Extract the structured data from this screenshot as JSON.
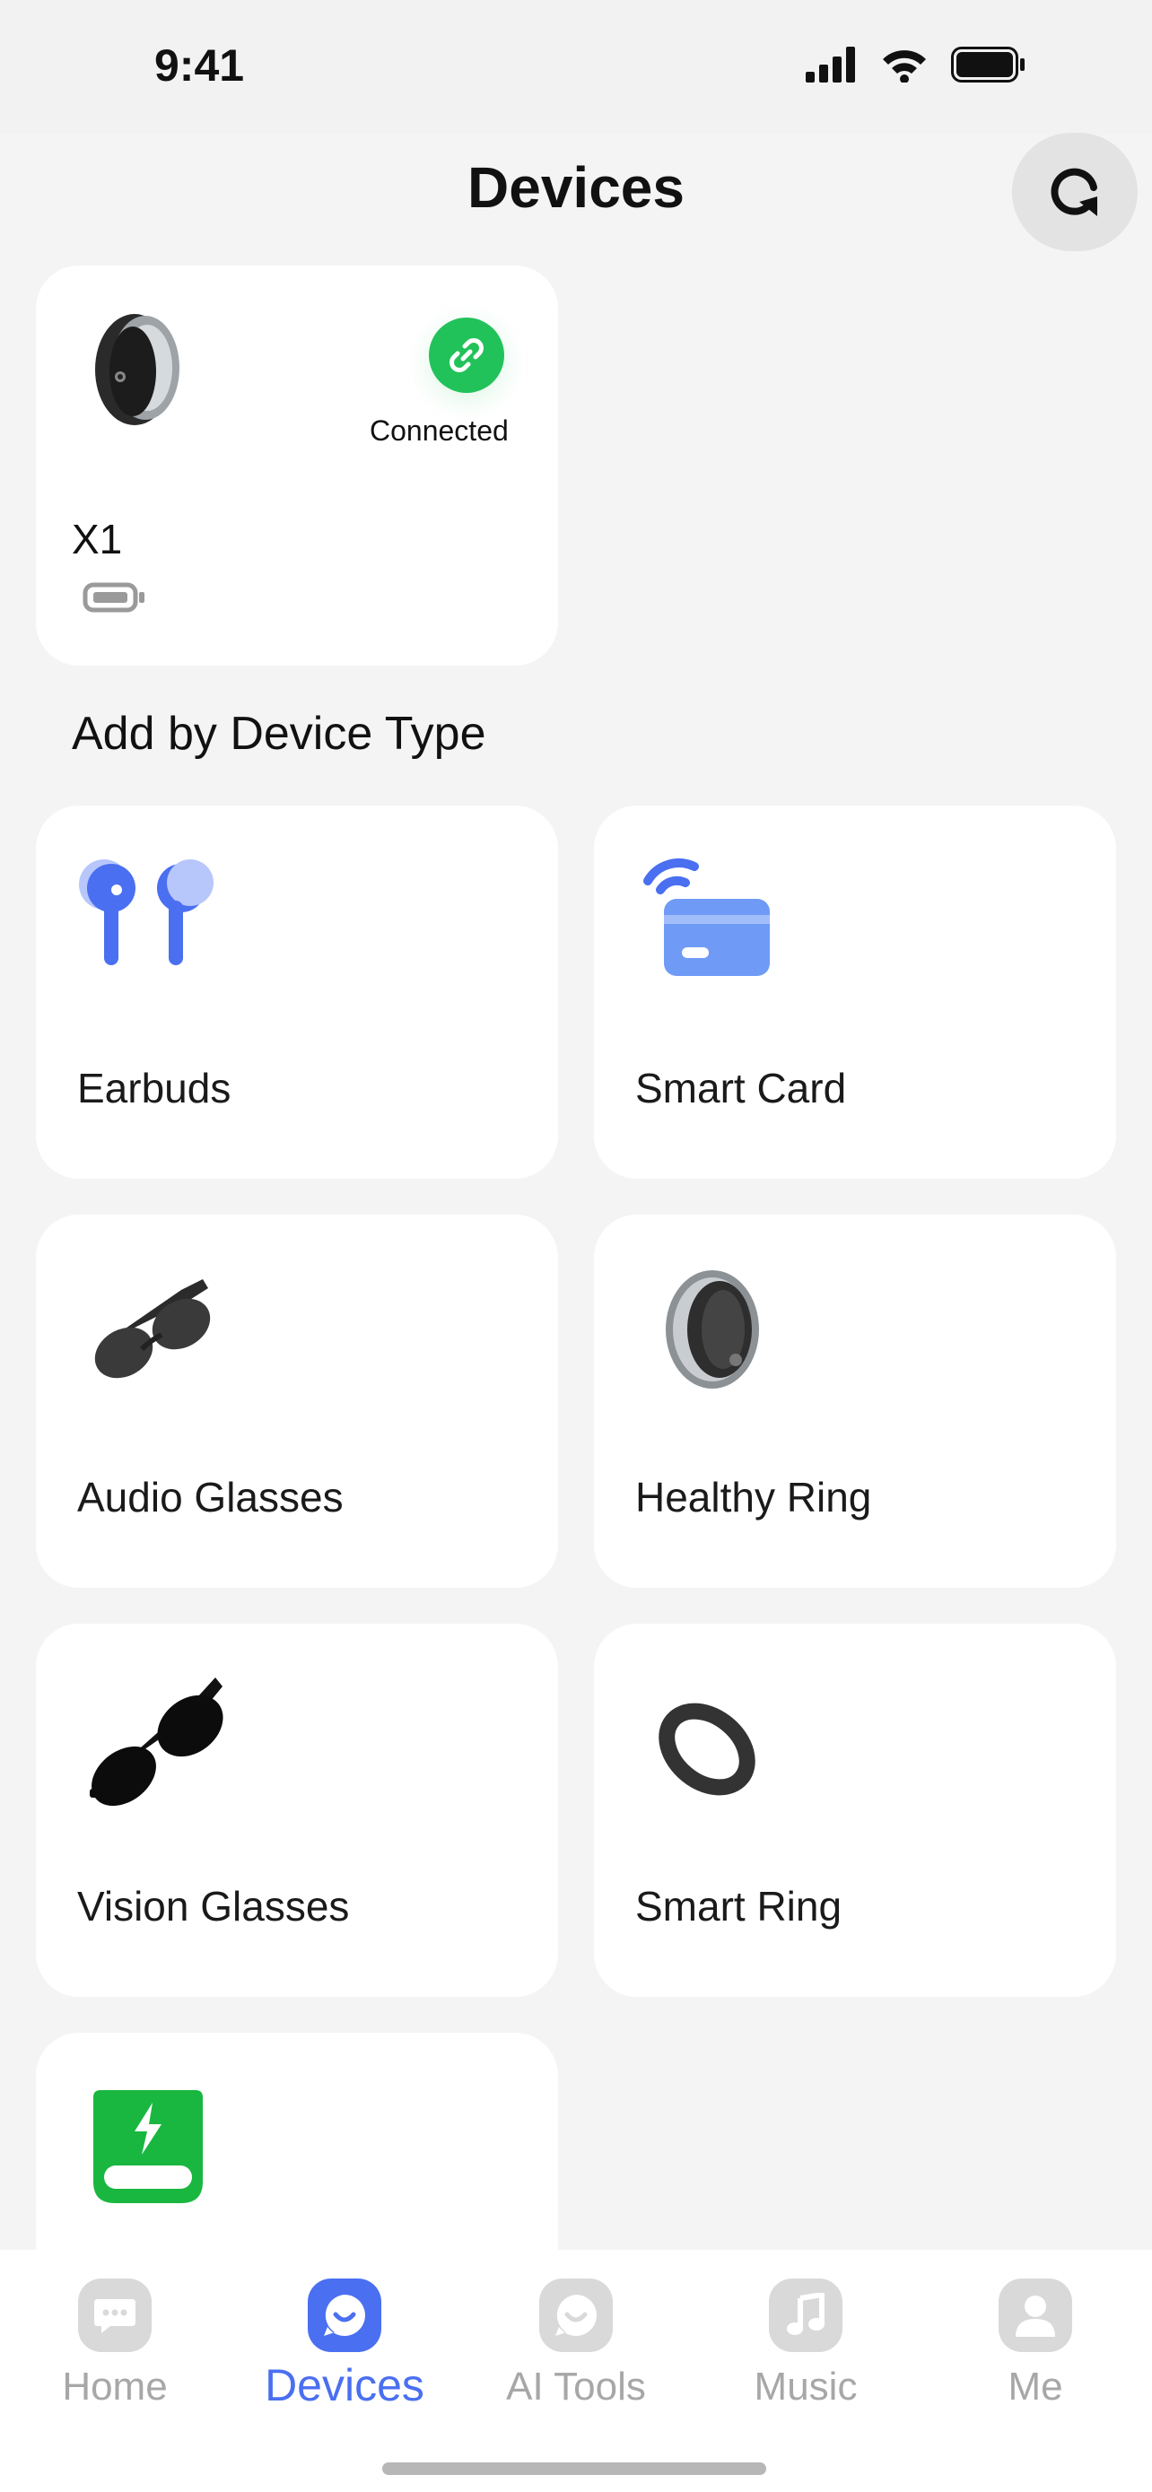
{
  "status_bar": {
    "time": "9:41"
  },
  "header": {
    "title": "Devices"
  },
  "connected_device": {
    "name": "X1",
    "status": "Connected"
  },
  "section": {
    "title": "Add by Device Type"
  },
  "device_types": [
    {
      "label": "Earbuds",
      "icon": "earbuds-icon"
    },
    {
      "label": "Smart Card",
      "icon": "smart-card-icon"
    },
    {
      "label": "Audio Glasses",
      "icon": "audio-glasses-icon"
    },
    {
      "label": "Healthy Ring",
      "icon": "healthy-ring-icon"
    },
    {
      "label": "Vision Glasses",
      "icon": "vision-glasses-icon"
    },
    {
      "label": "Smart Ring",
      "icon": "smart-ring-icon"
    },
    {
      "label": "",
      "icon": "power-bank-icon"
    }
  ],
  "tabs": [
    {
      "label": "Home",
      "icon": "chat-icon",
      "active": false
    },
    {
      "label": "Devices",
      "icon": "devices-icon",
      "active": true
    },
    {
      "label": "AI Tools",
      "icon": "ai-tools-icon",
      "active": false
    },
    {
      "label": "Music",
      "icon": "music-icon",
      "active": false
    },
    {
      "label": "Me",
      "icon": "person-icon",
      "active": false
    }
  ],
  "colors": {
    "accent": "#4a6ff0",
    "connected": "#22c25a",
    "background": "#f4f4f4"
  }
}
